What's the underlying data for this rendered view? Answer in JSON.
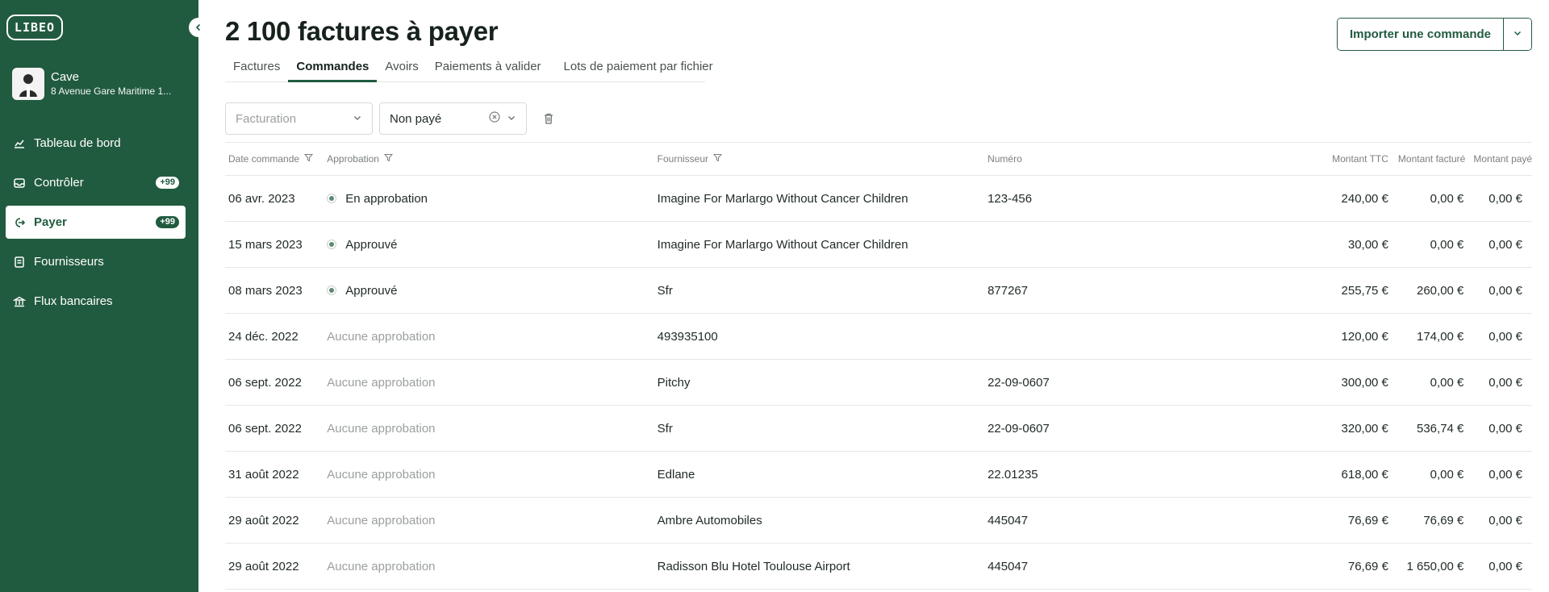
{
  "sidebar": {
    "logo": "LIBEO",
    "account": {
      "name": "Cave",
      "address": "8 Avenue Gare Maritime 1..."
    },
    "nav": [
      {
        "label": "Tableau de bord",
        "icon": "chart-icon",
        "badge": ""
      },
      {
        "label": "Contrôler",
        "icon": "inbox-icon",
        "badge": "+99"
      },
      {
        "label": "Payer",
        "icon": "pay-icon",
        "badge": "+99",
        "active": true
      },
      {
        "label": "Fournisseurs",
        "icon": "document-icon",
        "badge": ""
      },
      {
        "label": "Flux bancaires",
        "icon": "bank-icon",
        "badge": ""
      }
    ]
  },
  "header": {
    "title": "2 100 factures à payer",
    "import_label": "Importer une commande"
  },
  "tabs": [
    {
      "label": "Factures"
    },
    {
      "label": "Commandes",
      "active": true
    },
    {
      "label": "Avoirs"
    },
    {
      "label": "Paiements à valider"
    },
    {
      "label": "Lots de paiement par fichier"
    }
  ],
  "filters": {
    "facturation_placeholder": "Facturation",
    "statut_value": "Non payé"
  },
  "table": {
    "columns": {
      "date": "Date commande",
      "approbation": "Approbation",
      "fournisseur": "Fournisseur",
      "numero": "Numéro",
      "ttc": "Montant TTC",
      "facture": "Montant facturé",
      "paye": "Montant payé"
    },
    "rows": [
      {
        "date": "06 avr. 2023",
        "approbation": "En approbation",
        "status": "pending",
        "fournisseur": "Imagine For Marlargo Without Cancer Children",
        "numero": "123-456",
        "ttc": "240,00 €",
        "facture": "0,00 €",
        "paye": "0,00 €"
      },
      {
        "date": "15 mars 2023",
        "approbation": "Approuvé",
        "status": "approved",
        "fournisseur": "Imagine For Marlargo Without Cancer Children",
        "numero": "",
        "ttc": "30,00 €",
        "facture": "0,00 €",
        "paye": "0,00 €"
      },
      {
        "date": "08 mars 2023",
        "approbation": "Approuvé",
        "status": "approved",
        "fournisseur": "Sfr",
        "numero": "877267",
        "ttc": "255,75 €",
        "facture": "260,00 €",
        "paye": "0,00 €"
      },
      {
        "date": "24 déc. 2022",
        "approbation": "Aucune approbation",
        "status": "none",
        "fournisseur": "493935100",
        "numero": "",
        "ttc": "120,00 €",
        "facture": "174,00 €",
        "paye": "0,00 €"
      },
      {
        "date": "06 sept. 2022",
        "approbation": "Aucune approbation",
        "status": "none",
        "fournisseur": "Pitchy",
        "numero": "22-09-0607",
        "ttc": "300,00 €",
        "facture": "0,00 €",
        "paye": "0,00 €"
      },
      {
        "date": "06 sept. 2022",
        "approbation": "Aucune approbation",
        "status": "none",
        "fournisseur": "Sfr",
        "numero": "22-09-0607",
        "ttc": "320,00 €",
        "facture": "536,74 €",
        "paye": "0,00 €"
      },
      {
        "date": "31 août 2022",
        "approbation": "Aucune approbation",
        "status": "none",
        "fournisseur": "Edlane",
        "numero": "22.01235",
        "ttc": "618,00 €",
        "facture": "0,00 €",
        "paye": "0,00 €"
      },
      {
        "date": "29 août 2022",
        "approbation": "Aucune approbation",
        "status": "none",
        "fournisseur": "Ambre Automobiles",
        "numero": "445047",
        "ttc": "76,69 €",
        "facture": "76,69 €",
        "paye": "0,00 €"
      },
      {
        "date": "29 août 2022",
        "approbation": "Aucune approbation",
        "status": "none",
        "fournisseur": "Radisson Blu Hotel Toulouse Airport",
        "numero": "445047",
        "ttc": "76,69 €",
        "facture": "1 650,00 €",
        "paye": "0,00 €"
      }
    ]
  },
  "colors": {
    "brand": "#215b3f",
    "muted": "#9aa09d",
    "border": "#e6e8e7"
  }
}
